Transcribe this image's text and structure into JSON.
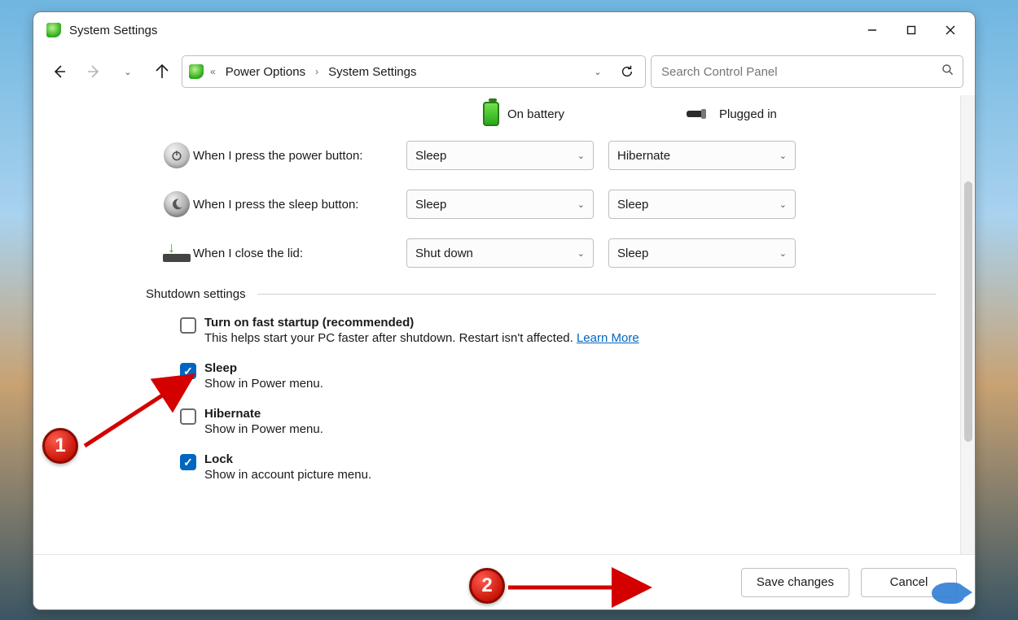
{
  "window": {
    "title": "System Settings"
  },
  "breadcrumb": {
    "items": [
      "Power Options",
      "System Settings"
    ]
  },
  "search": {
    "placeholder": "Search Control Panel"
  },
  "columns": {
    "battery": "On battery",
    "plugged": "Plugged in"
  },
  "rows": {
    "power": {
      "label": "When I press the power button:",
      "battery": "Sleep",
      "plugged": "Hibernate"
    },
    "sleep": {
      "label": "When I press the sleep button:",
      "battery": "Sleep",
      "plugged": "Sleep"
    },
    "lid": {
      "label": "When I close the lid:",
      "battery": "Shut down",
      "plugged": "Sleep"
    }
  },
  "section": {
    "title": "Shutdown settings"
  },
  "shutdown": {
    "faststartup": {
      "checked": false,
      "title": "Turn on fast startup (recommended)",
      "desc": "This helps start your PC faster after shutdown. Restart isn't affected. ",
      "link": "Learn More"
    },
    "sleep": {
      "checked": true,
      "title": "Sleep",
      "desc": "Show in Power menu."
    },
    "hibernate": {
      "checked": false,
      "title": "Hibernate",
      "desc": "Show in Power menu."
    },
    "lock": {
      "checked": true,
      "title": "Lock",
      "desc": "Show in account picture menu."
    }
  },
  "footer": {
    "save": "Save changes",
    "cancel": "Cancel"
  },
  "annotations": {
    "one": "1",
    "two": "2"
  }
}
